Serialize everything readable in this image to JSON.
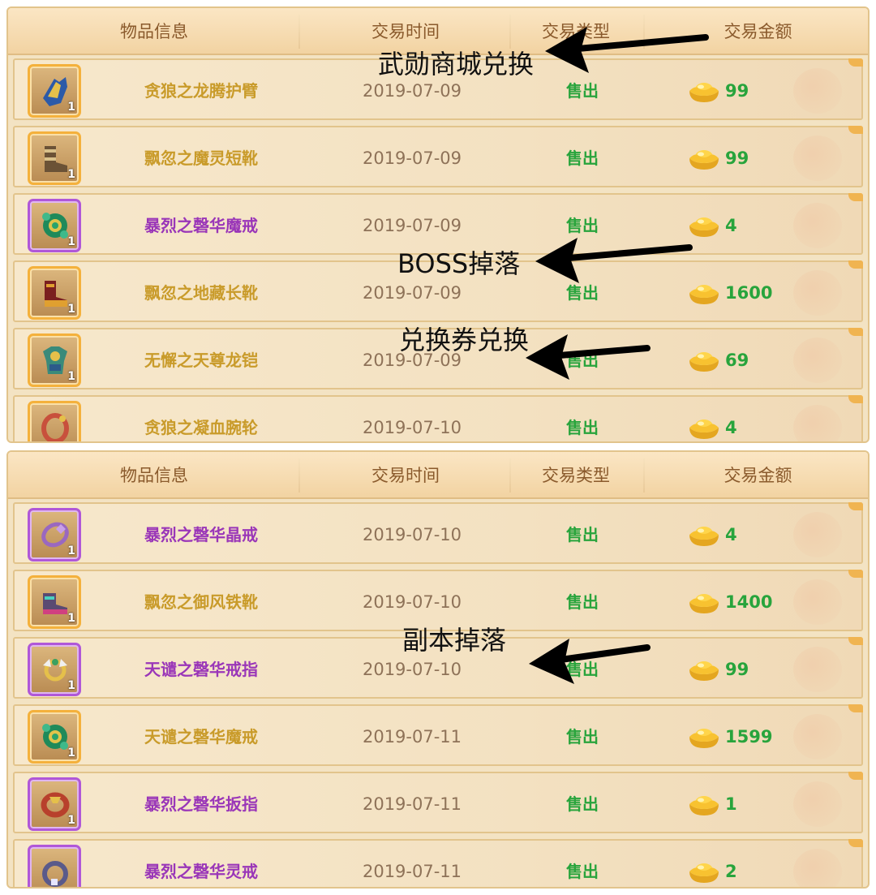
{
  "columns": [
    "物品信息",
    "交易时间",
    "交易类型",
    "交易金额"
  ],
  "colors": {
    "gold_name": "#c99b2a",
    "purple_name": "#9a36b8",
    "sale_green": "#28a43c",
    "date_gray": "#8e7258",
    "header_text": "#8a5a2c"
  },
  "panel_a": {
    "rows": [
      {
        "name": "贪狼之龙腾护臂",
        "date": "2019-07-09",
        "type": "售出",
        "amount": "99",
        "count": "1",
        "rarity": "gold",
        "icon": "bracer-icon"
      },
      {
        "name": "飘忽之魔灵短靴",
        "date": "2019-07-09",
        "type": "售出",
        "amount": "99",
        "count": "1",
        "rarity": "gold",
        "icon": "boots-icon"
      },
      {
        "name": "暴烈之磬华魔戒",
        "date": "2019-07-09",
        "type": "售出",
        "amount": "4",
        "count": "1",
        "rarity": "purple",
        "icon": "green-ring-icon"
      },
      {
        "name": "飘忽之地藏长靴",
        "date": "2019-07-09",
        "type": "售出",
        "amount": "1600",
        "count": "1",
        "rarity": "gold",
        "icon": "red-boots-icon"
      },
      {
        "name": "无懈之天尊龙铠",
        "date": "2019-07-09",
        "type": "售出",
        "amount": "69",
        "count": "1",
        "rarity": "gold",
        "icon": "armor-icon"
      },
      {
        "name": "贪狼之凝血腕轮",
        "date": "2019-07-10",
        "type": "售出",
        "amount": "4",
        "count": "",
        "rarity": "gold",
        "icon": "bracelet-icon"
      }
    ]
  },
  "panel_b": {
    "rows": [
      {
        "name": "暴烈之磬华晶戒",
        "date": "2019-07-10",
        "type": "售出",
        "amount": "4",
        "count": "1",
        "rarity": "purple",
        "icon": "crystal-ring-icon"
      },
      {
        "name": "飘忽之御风铁靴",
        "date": "2019-07-10",
        "type": "售出",
        "amount": "1400",
        "count": "1",
        "rarity": "gold",
        "icon": "iron-boots-icon"
      },
      {
        "name": "天谴之磬华戒指",
        "date": "2019-07-10",
        "type": "售出",
        "amount": "99",
        "count": "1",
        "rarity": "purple",
        "icon": "winged-ring-icon"
      },
      {
        "name": "天谴之磬华魔戒",
        "date": "2019-07-11",
        "type": "售出",
        "amount": "1599",
        "count": "1",
        "rarity": "gold",
        "icon": "green-ring-icon"
      },
      {
        "name": "暴烈之磬华扳指",
        "date": "2019-07-11",
        "type": "售出",
        "amount": "1",
        "count": "1",
        "rarity": "purple",
        "icon": "thumb-ring-icon"
      },
      {
        "name": "暴烈之磬华灵戒",
        "date": "2019-07-11",
        "type": "售出",
        "amount": "2",
        "count": "",
        "rarity": "purple",
        "icon": "spirit-ring-icon"
      }
    ]
  },
  "annotations": {
    "wuxun": "武勋商城兑换",
    "boss": "BOSS掉落",
    "coupon": "兑换券兑换",
    "dungeon": "副本掉落"
  }
}
